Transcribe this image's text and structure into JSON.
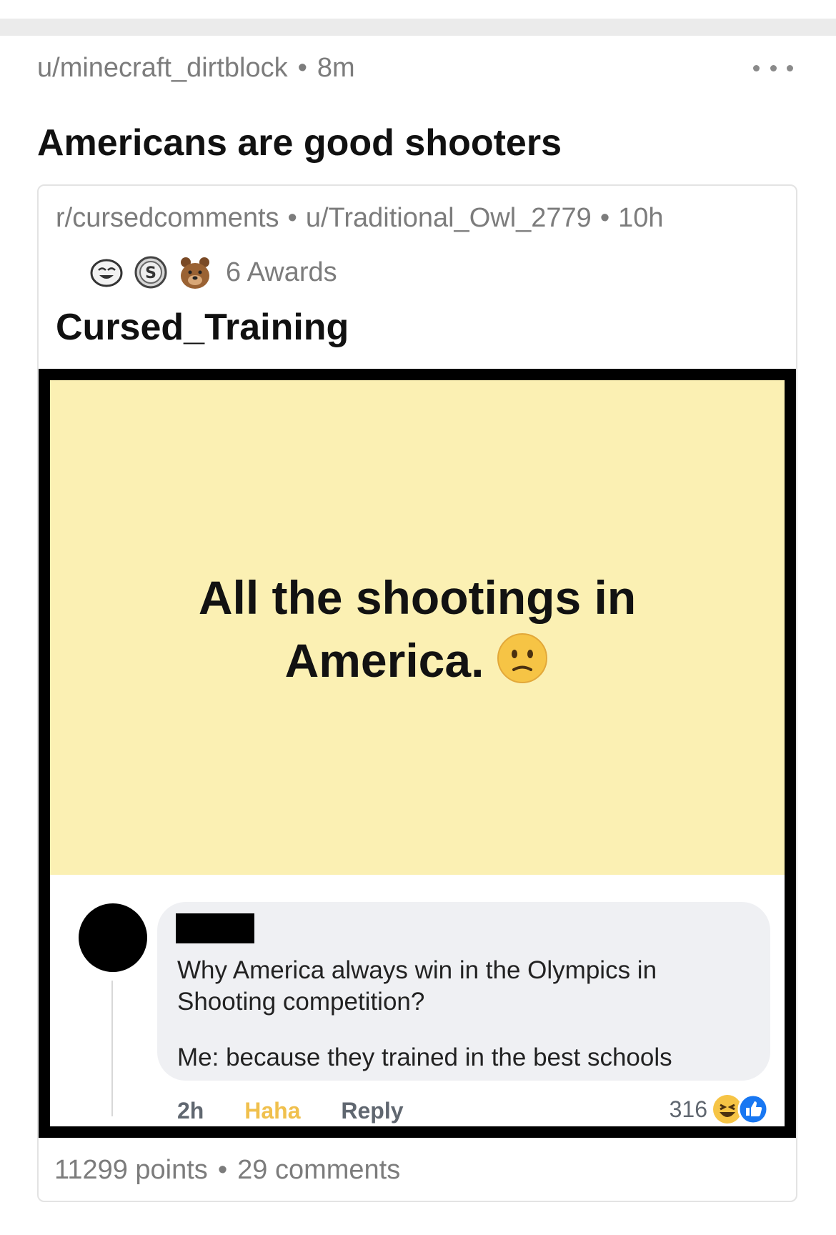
{
  "post": {
    "author": "u/minecraft_dirtblock",
    "age": "8m",
    "separator": "•",
    "title": "Americans are good shooters"
  },
  "crosspost": {
    "subreddit": "r/cursedcomments",
    "author": "u/Traditional_Owl_2779",
    "age": "10h",
    "awards_label": "6 Awards",
    "awards_icons": [
      "laughing-award-icon",
      "silver-award-icon",
      "bear-award-icon"
    ],
    "title": "Cursed_Training",
    "points": "11299 points",
    "comments": "29 comments"
  },
  "image": {
    "status_line1": "All the shootings in",
    "status_line2": "America.",
    "status_emoji": "confused-face-emoji",
    "panel_color": "#fbf0b3",
    "comment_line1": "Why America always win in the Olympics in Shooting competition?",
    "comment_line2": "Me: because they trained in the best schools",
    "comment_time": "2h",
    "comment_haha": "Haha",
    "comment_reply": "Reply",
    "reaction_count": "316"
  },
  "colors": {
    "meta_gray": "#7c7c7c",
    "haha_yellow": "#f0c04d",
    "like_blue": "#1877f2"
  }
}
